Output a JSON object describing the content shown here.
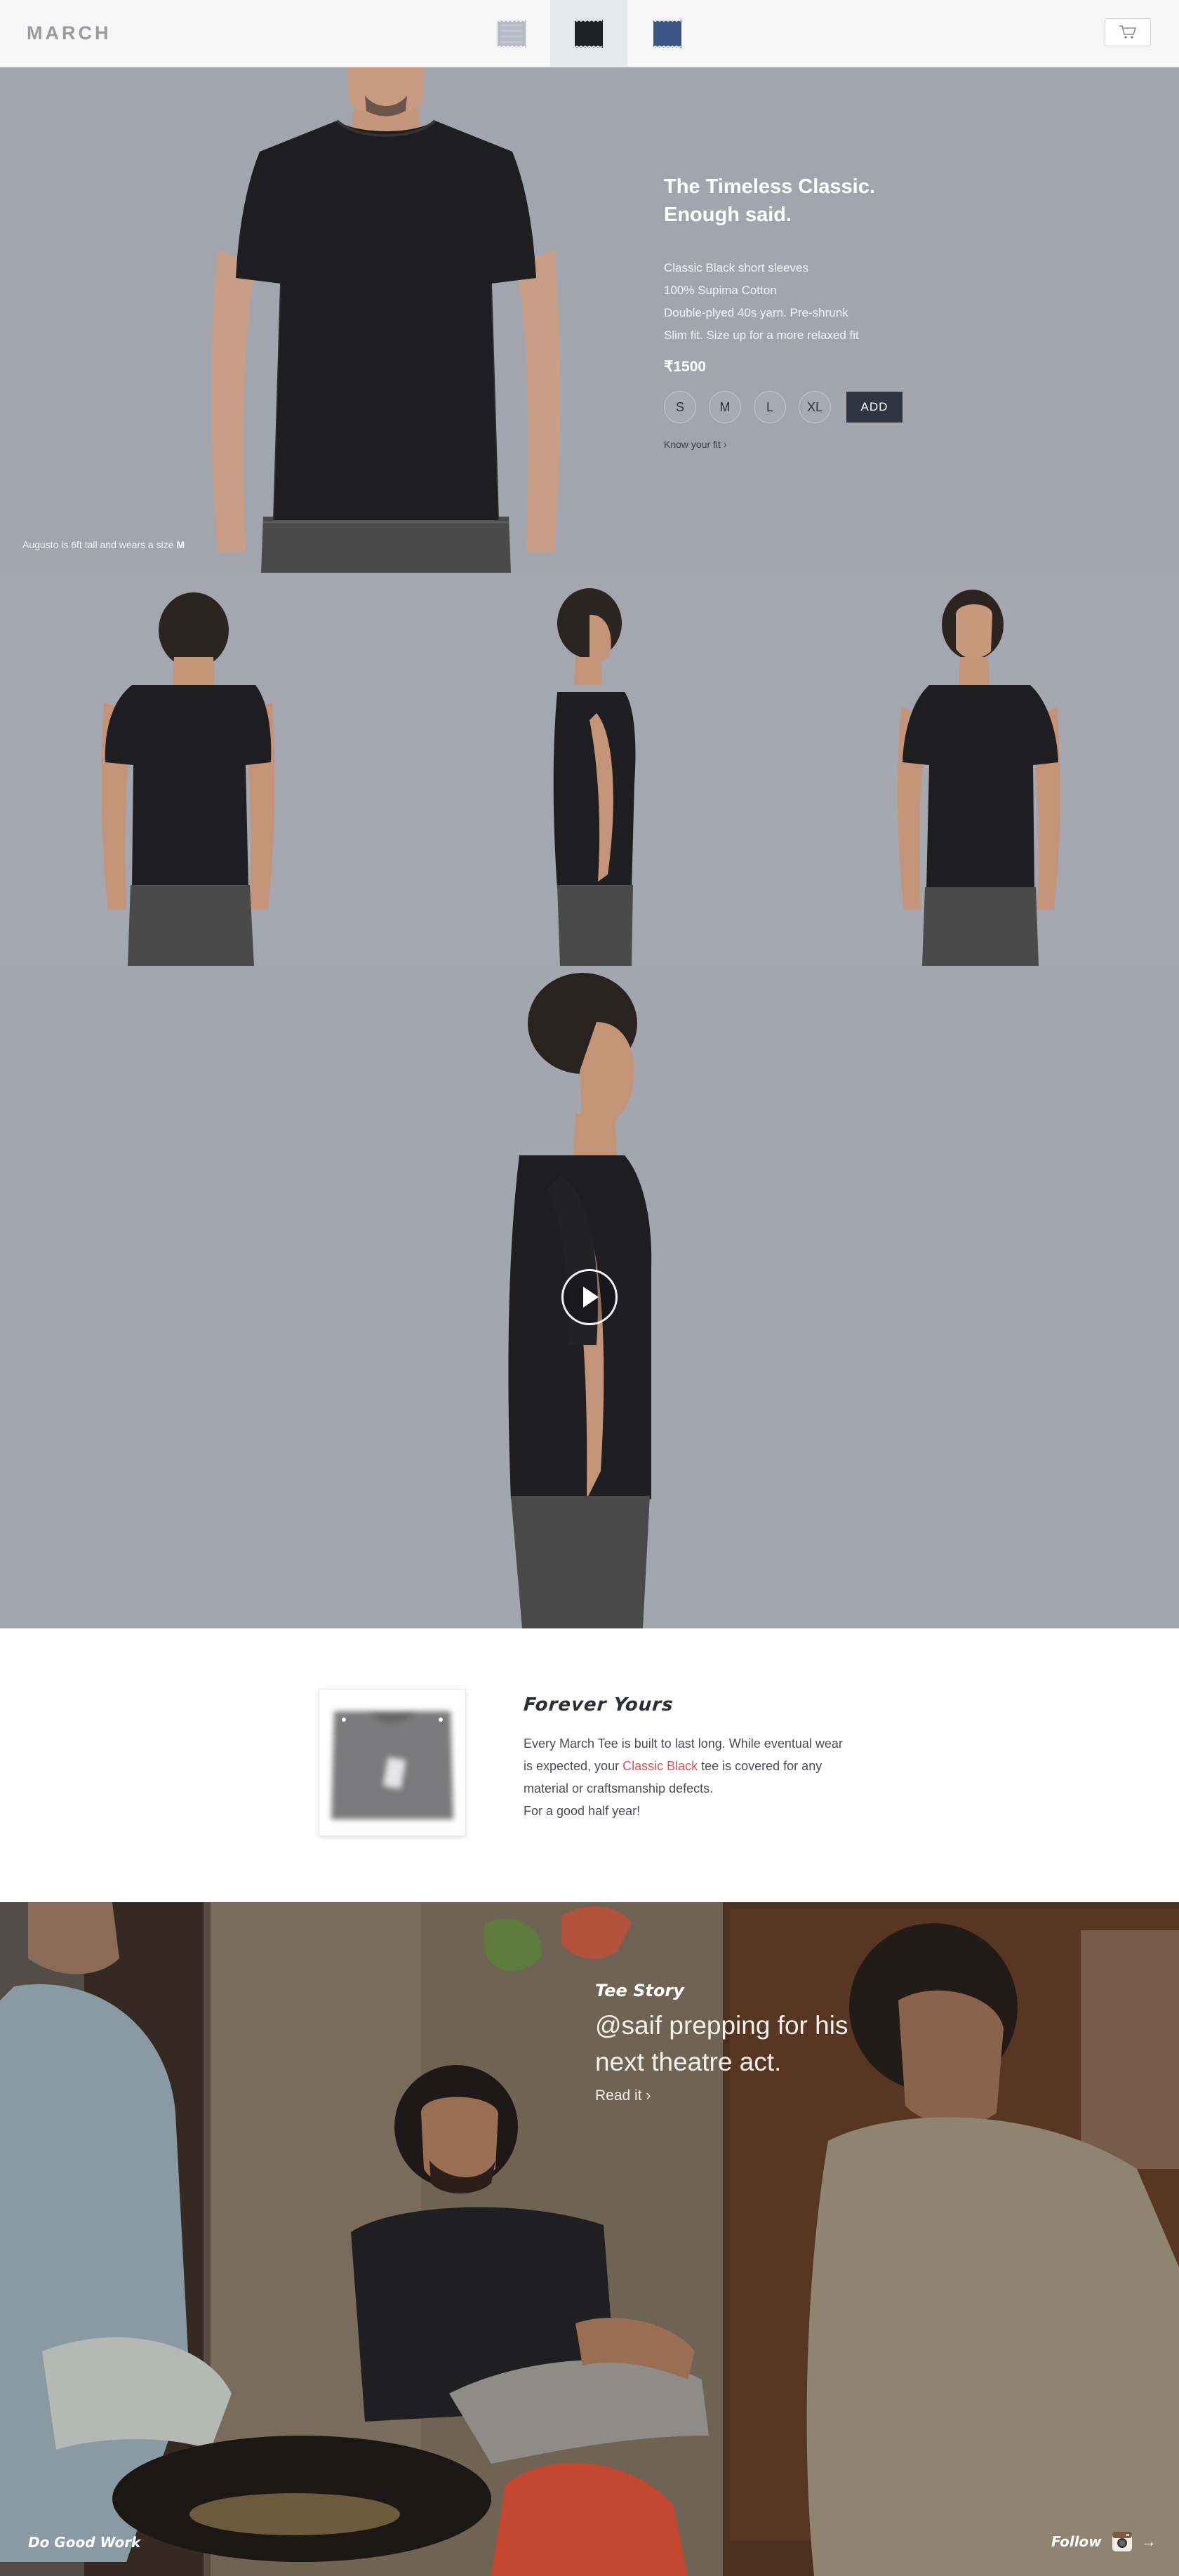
{
  "header": {
    "brand": "MARCH",
    "swatches": [
      {
        "name": "grey",
        "color": "#b5b8c4"
      },
      {
        "name": "black",
        "color": "#1f2023"
      },
      {
        "name": "navy",
        "color": "#3c5584"
      }
    ],
    "active_swatch": "black",
    "cart_icon": "cart-icon"
  },
  "hero": {
    "title_line1": "The Timeless Classic.",
    "title_line2": "Enough said.",
    "features": [
      "Classic Black short sleeves",
      "100% Supima Cotton",
      "Double-plyed 40s yarn. Pre-shrunk",
      "Slim fit. Size up for a more relaxed fit"
    ],
    "price": "₹1500",
    "sizes": [
      "S",
      "M",
      "L",
      "XL"
    ],
    "add_label": "ADD",
    "fit_link": "Know your fit ›",
    "fit_caption": "Augusto is 6ft tall and wears a size",
    "fit_caption_size": "M"
  },
  "warranty": {
    "title": "Forever Yours",
    "body_before": "Every March Tee is built to last long. While eventual wear is expected, your ",
    "body_accent": "Classic Black",
    "body_after": " tee is covered for any material or craftsmanship defects.",
    "body_last": "For a good half year!",
    "accent_color": "#e0505a"
  },
  "story": {
    "label": "Tee Story",
    "headline_line1": "@saif prepping for his",
    "headline_line2": "next theatre act.",
    "link": "Read it ›"
  },
  "footer": {
    "left": "Do Good Work",
    "right": "Follow",
    "icon": "instagram-icon",
    "arrow": "→"
  }
}
